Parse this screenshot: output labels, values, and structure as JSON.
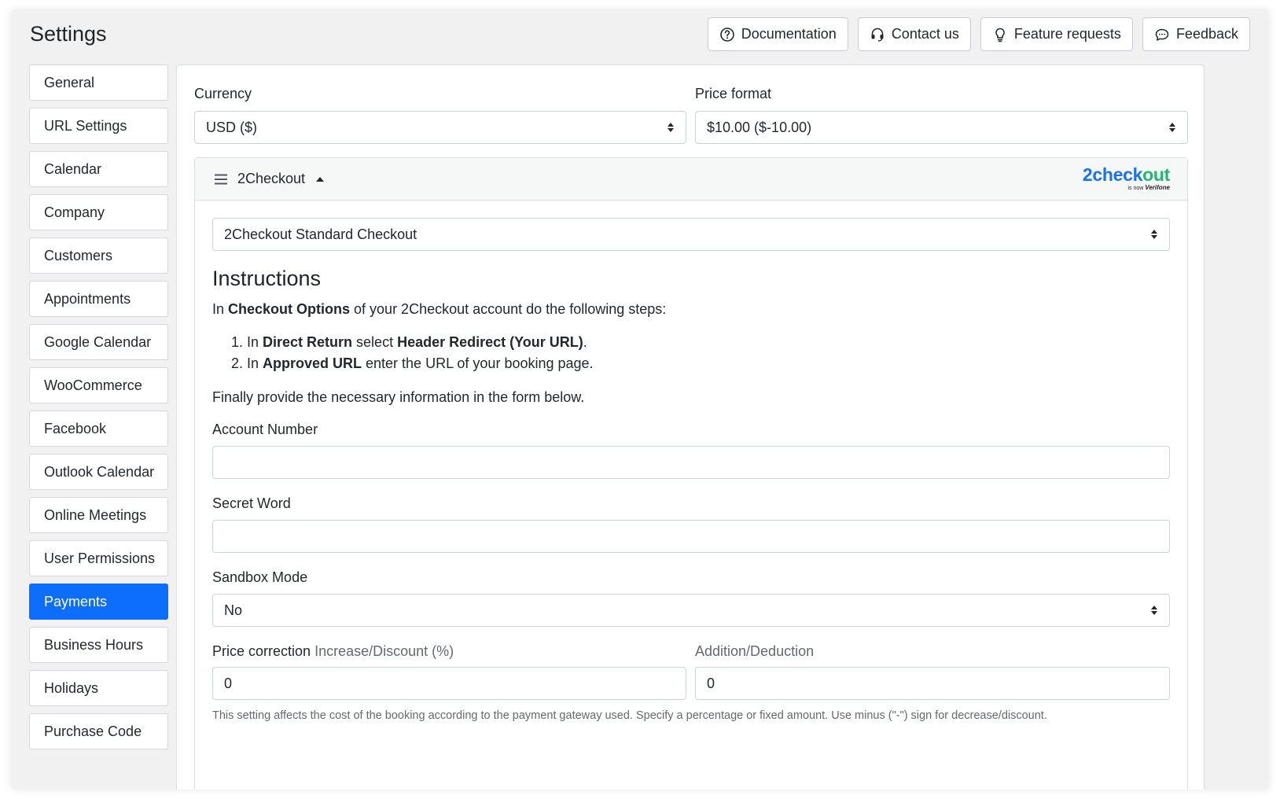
{
  "header": {
    "title": "Settings",
    "buttons": [
      {
        "label": "Documentation",
        "icon": "question-circle-icon"
      },
      {
        "label": "Contact us",
        "icon": "headset-icon"
      },
      {
        "label": "Feature requests",
        "icon": "lightbulb-icon"
      },
      {
        "label": "Feedback",
        "icon": "chat-bubble-icon"
      }
    ]
  },
  "sidebar": {
    "items": [
      {
        "label": "General"
      },
      {
        "label": "URL Settings"
      },
      {
        "label": "Calendar"
      },
      {
        "label": "Company"
      },
      {
        "label": "Customers"
      },
      {
        "label": "Appointments"
      },
      {
        "label": "Google Calendar"
      },
      {
        "label": "WooCommerce"
      },
      {
        "label": "Facebook"
      },
      {
        "label": "Outlook Calendar"
      },
      {
        "label": "Online Meetings"
      },
      {
        "label": "User Permissions"
      },
      {
        "label": "Payments"
      },
      {
        "label": "Business Hours"
      },
      {
        "label": "Holidays"
      },
      {
        "label": "Purchase Code"
      }
    ],
    "active": "Payments",
    "active_color": "#0d6efd"
  },
  "payments": {
    "currency_label": "Currency",
    "currency_value": "USD ($)",
    "price_format_label": "Price format",
    "price_format_value": "$10.00 ($-10.00)"
  },
  "gateway": {
    "name": "2Checkout",
    "logo_text": "2checkout",
    "logo_sub": "is now",
    "logo_brand": "Verifone",
    "logo_color_main": "#1a73e8",
    "logo_color_accent": "#21b573",
    "checkout_type": "2Checkout Standard Checkout",
    "instructions_title": "Instructions",
    "intro_prefix": "In ",
    "intro_bold": "Checkout Options",
    "intro_suffix": " of your 2Checkout account do the following steps:",
    "steps": [
      {
        "prefix": "In ",
        "bold1": "Direct Return",
        "middle": " select ",
        "bold2": "Header Redirect (Your URL)",
        "suffix": "."
      },
      {
        "prefix": "In ",
        "bold1": "Approved URL",
        "middle": " enter the URL of your booking page.",
        "bold2": "",
        "suffix": ""
      }
    ],
    "finally_text": "Finally provide the necessary information in the form below.",
    "account_number_label": "Account Number",
    "account_number_value": "",
    "secret_word_label": "Secret Word",
    "secret_word_value": "",
    "sandbox_label": "Sandbox Mode",
    "sandbox_value": "No",
    "price_correction_label": "Price correction",
    "increase_label": "Increase/Discount (%)",
    "increase_value": "0",
    "addition_label": "Addition/Deduction",
    "addition_value": "0",
    "help_text": "This setting affects the cost of the booking according to the payment gateway used. Specify a percentage or fixed amount. Use minus (\"-\") sign for decrease/discount."
  }
}
